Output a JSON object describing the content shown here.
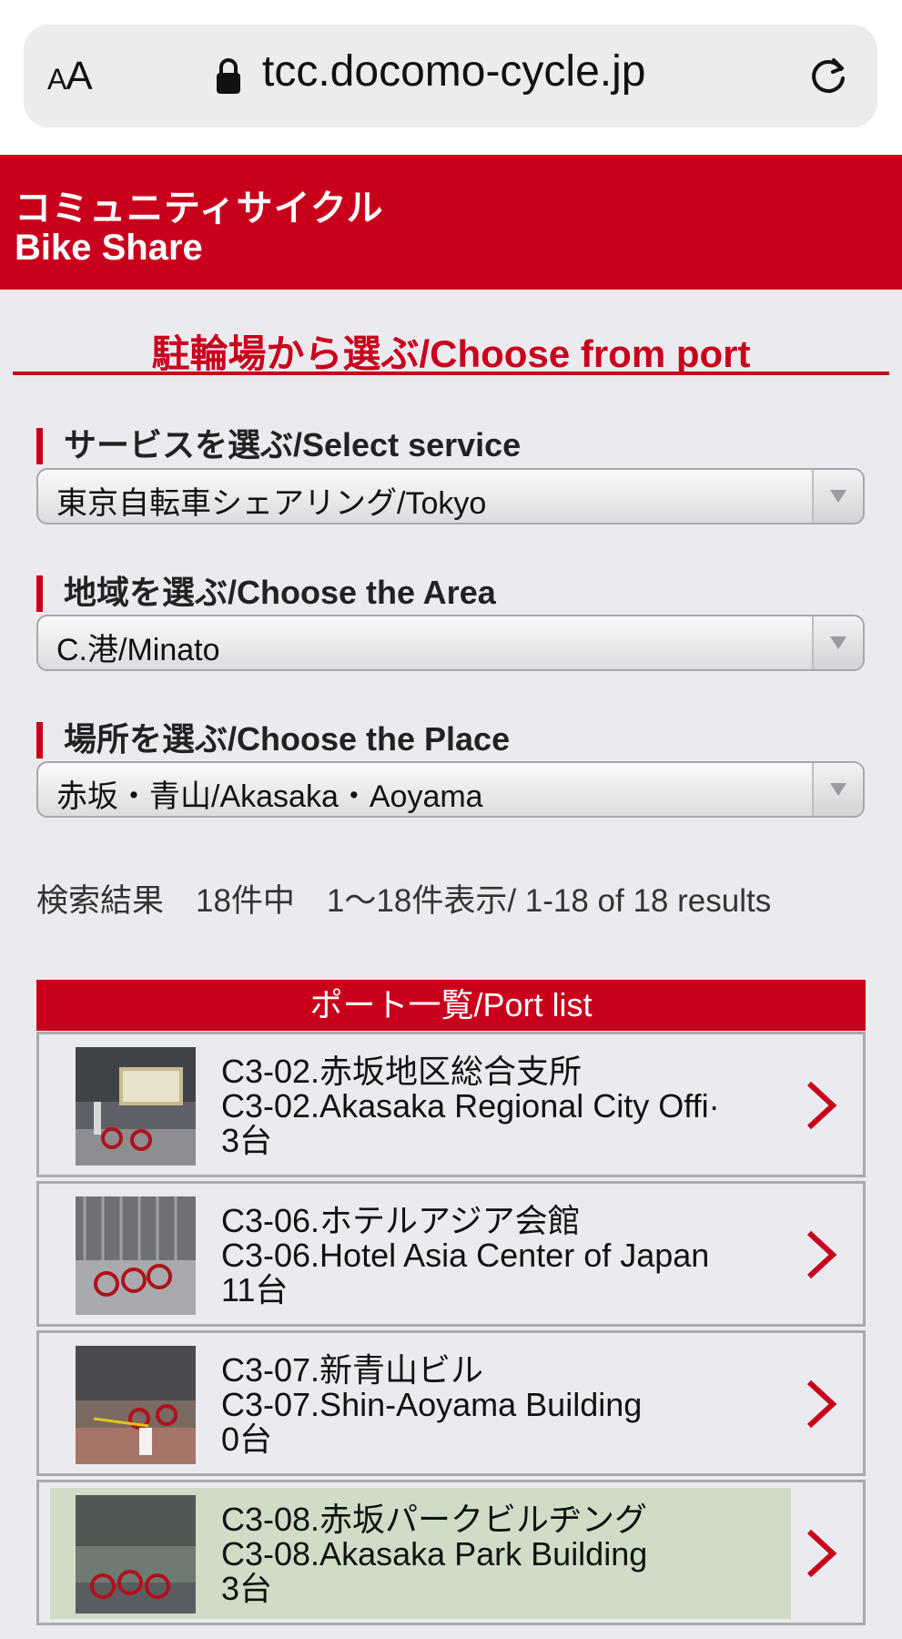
{
  "browser": {
    "text_size_label": "AA",
    "url": "tcc.docomo-cycle.jp"
  },
  "banner": {
    "title_jp": "コミュニティサイクル",
    "title_en": "Bike Share"
  },
  "section_title": "駐輪場から選ぶ/Choose from port",
  "filters": [
    {
      "label": "サービスを選ぶ/Select service",
      "value": "東京自転車シェアリング/Tokyo"
    },
    {
      "label": "地域を選ぶ/Choose the Area",
      "value": "C.港/Minato"
    },
    {
      "label": "場所を選ぶ/Choose the Place",
      "value": "赤坂・青山/Akasaka・Aoyama"
    }
  ],
  "results_text": "検索結果　18件中　1〜18件表示/ 1-18 of 18 results",
  "port_list": {
    "header": "ポート一覧/Port list",
    "items": [
      {
        "name_jp": "C3-02.赤坂地区総合支所",
        "name_en": "C3-02.Akasaka Regional City Offi·",
        "count": "3台",
        "highlighted": false
      },
      {
        "name_jp": "C3-06.ホテルアジア会館",
        "name_en": "C3-06.Hotel Asia Center of Japan",
        "count": "11台",
        "highlighted": false
      },
      {
        "name_jp": "C3-07.新青山ビル",
        "name_en": "C3-07.Shin-Aoyama Building",
        "count": "0台",
        "highlighted": false
      },
      {
        "name_jp": "C3-08.赤坂パークビルヂング",
        "name_en": "C3-08.Akasaka Park Building",
        "count": "3台",
        "highlighted": true
      }
    ]
  },
  "colors": {
    "brand_red": "#c9001c",
    "highlight_green": "#cfddc7"
  }
}
